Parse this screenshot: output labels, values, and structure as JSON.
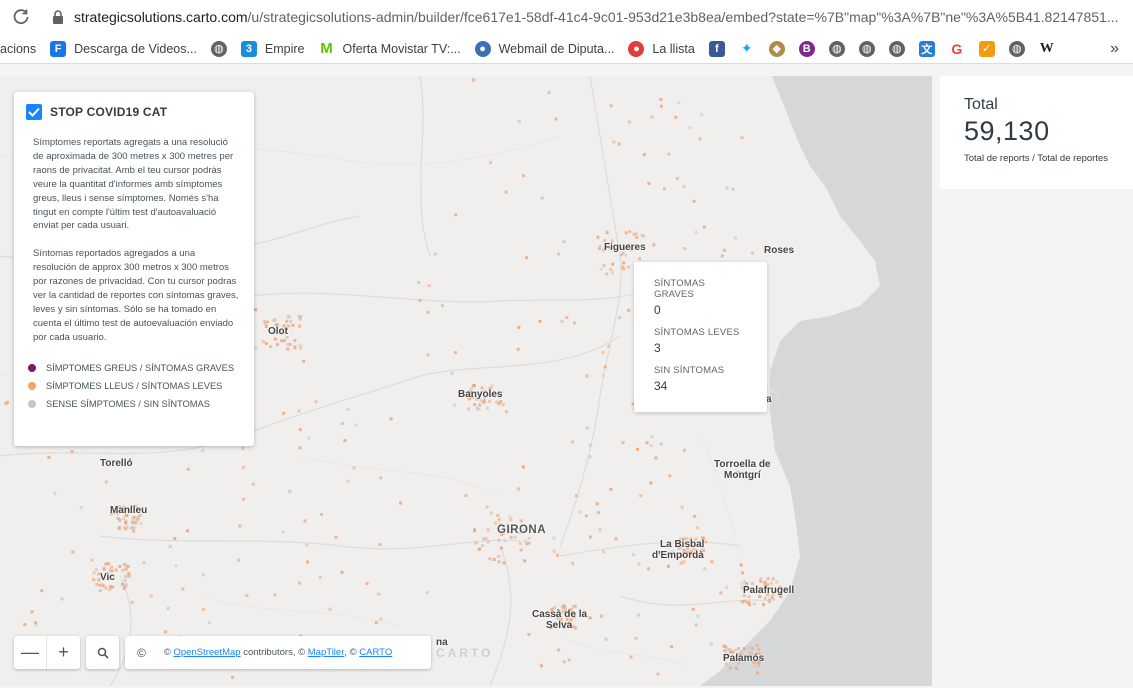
{
  "browser": {
    "url_main": "strategicsolutions.carto.com",
    "url_rest": "/u/strategicsolutions-admin/builder/fce617e1-58df-41c4-9c01-953d21e3b8ea/embed?state=%7B\"map\"%3A%7B\"ne\"%3A%5B41.82147851...",
    "bookmarks": [
      {
        "label": "acions",
        "icon": "none"
      },
      {
        "label": "Descarga de Videos...",
        "icon": "f-icon",
        "color": "#1a73e8"
      },
      {
        "label": "",
        "icon": "globe-icon",
        "color": "#5f6368"
      },
      {
        "label": "Empire",
        "icon": "3-icon",
        "color": "#1a8cd8"
      },
      {
        "label": "Oferta Movistar TV:...",
        "icon": "movistar-icon",
        "color": "#5bc500"
      },
      {
        "label": "Webmail de Diputa...",
        "icon": "webmail-icon",
        "color": "#3b6fb6"
      },
      {
        "label": "La llista",
        "icon": "llista-icon",
        "color": "#e23b3b"
      },
      {
        "label": "",
        "icon": "facebook-icon",
        "color": "#3b5998"
      },
      {
        "label": "",
        "icon": "twitter-icon",
        "color": "#1da1f2"
      }
    ]
  },
  "legend": {
    "title": "STOP COVID19 CAT",
    "desc_ca": "Símptomes reportats agregats a una resolució de aproximada de 300 metres x 300 metres per raons de privacitat. Amb el teu cursor podràs veure la quantitat d'informes amb símptomes greus, lleus i sense símptomes. Només s'ha tingut en compte l'últim test d'autoavaluació enviat per cada usuari.",
    "desc_es": "Síntomas reportados agregados a una resolución de approx 300 metros x 300 metros por razones de privacidad. Con tu cursor podras ver la cantidad de reportes con síntomas graves, leves y sin síntomas. Sólo se ha tomado en cuenta el último test de autoevaluación enviado por cada usuario.",
    "items": [
      {
        "label": "SÍMPTOMES GREUS / SÍNTOMAS GRAVES",
        "color": "#7b1a6b"
      },
      {
        "label": "SÍMPTOMES LLEUS / SÍNTOMAS LEVES",
        "color": "#f3a26c"
      },
      {
        "label": "SENSE SÍMPTOMES / SIN SÍNTOMAS",
        "color": "#c7c7c7"
      }
    ]
  },
  "popup": {
    "graves_label": "SÍNTOMAS GRAVES",
    "graves_value": "0",
    "leves_label": "SÍNTOMAS LEVES",
    "leves_value": "3",
    "sin_label": "SIN SÍNTOMAS",
    "sin_value": "34"
  },
  "places": {
    "figueres": "Figueres",
    "roses": "Roses",
    "olot": "Olot",
    "banyoles": "Banyoles",
    "torello": "Torelló",
    "manlleu": "Manlleu",
    "vic": "Vic",
    "girona": "GIRONA",
    "torroella1": "Torroella de",
    "torroella2": "Montgrí",
    "bisbal1": "La Bisbal",
    "bisbal2": "d'Empordà",
    "palafrugell": "Palafrugell",
    "cassa1": "Cassà de la",
    "cassa2": "Selva",
    "palamos": "Palamós",
    "partial_na": "na",
    "partial_a": "a"
  },
  "controls": {
    "zoom_out": "—",
    "zoom_in": "+",
    "attribution_prefix": "©",
    "osm": "OpenStreetMap",
    "contributors": "contributors, ©",
    "maptiler": "MapTiler",
    "sep": ", ©",
    "carto": "CARTO",
    "carto_logo": "CARTO"
  },
  "widget": {
    "title": "Total",
    "value": "59,130",
    "note": "Total de reports / Total de reportes"
  }
}
